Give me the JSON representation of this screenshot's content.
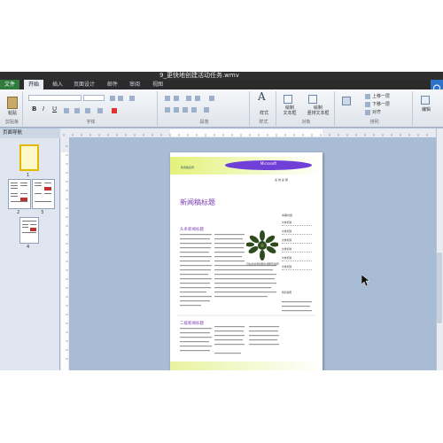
{
  "window": {
    "title": "9_更快地创建活动任务.wmv"
  },
  "tabs": [
    {
      "label": "文件"
    },
    {
      "label": "开始"
    },
    {
      "label": "插入"
    },
    {
      "label": "页面设计"
    },
    {
      "label": "邮件"
    },
    {
      "label": "审阅"
    },
    {
      "label": "视图"
    }
  ],
  "ribbon": {
    "paste_label": "粘贴",
    "group_clipboard": "剪贴板",
    "group_font": "字体",
    "group_paragraph": "段落",
    "group_styles": "样式",
    "styles_label": "样式",
    "group_objects": "对象",
    "draw_textbox_label": "绘制\n文本框",
    "draw_vertical_textbox_label": "绘制\n竖排文本框",
    "group_arrange": "排列",
    "bring_forward_label": "上移一层",
    "send_backward_label": "下移一层",
    "align_label": "对齐",
    "edit_label": "编辑"
  },
  "nav": {
    "header": "页面导航",
    "pages": [
      {
        "number": "1"
      },
      {
        "number": "2"
      },
      {
        "number": "3"
      },
      {
        "number": "4"
      }
    ]
  },
  "document": {
    "oval_text": "Microsoft",
    "newsletter_tag": "新闻稿名称",
    "issue_info": "第  卷  第  期",
    "title": "新闻稿标题",
    "article1_head": "头条新闻标题",
    "article2_head": "二级新闻标题",
    "caption": "可在此处添加图片或图形说明",
    "side_label": "本期内容",
    "side_items": [
      "文章标题",
      "文章标题",
      "文章标题",
      "文章标题",
      "文章标题",
      "文章标题"
    ],
    "side_label2": "特别说明"
  }
}
